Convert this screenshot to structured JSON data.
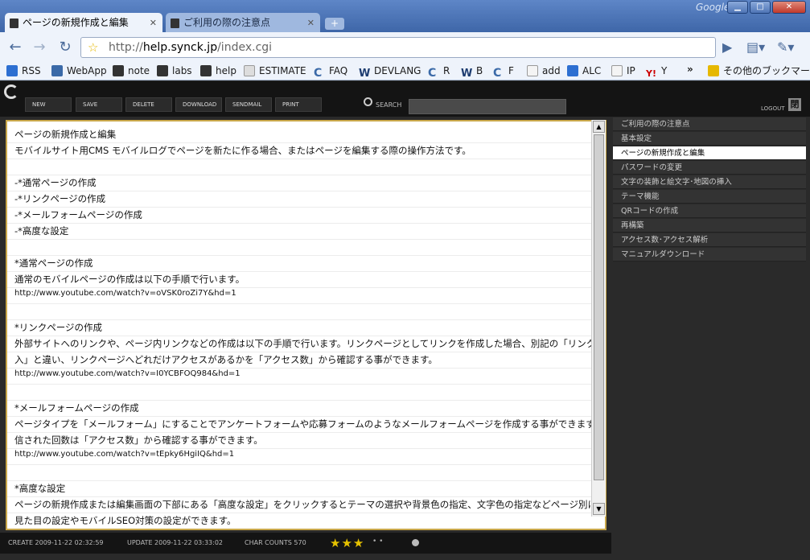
{
  "browser": {
    "brand": "Google",
    "tabs": [
      {
        "label": "ページの新規作成と編集"
      },
      {
        "label": "ご利用の際の注意点"
      }
    ],
    "url_prefix": "http://",
    "url_host": "help.synck.jp",
    "url_path": "/index.cgi",
    "bookmarks": [
      {
        "label": "RSS",
        "color": "#2d6fd1"
      },
      {
        "label": "WebApp",
        "color": "#3b6aa8"
      },
      {
        "label": "note",
        "color": "#333333"
      },
      {
        "label": "labs",
        "color": "#333333"
      },
      {
        "label": "help",
        "color": "#333333"
      },
      {
        "label": "ESTIMATE",
        "color": "#d8d8d8"
      },
      {
        "label": "FAQ",
        "color": "#3b6aa8"
      },
      {
        "label": "DEVLANG",
        "color": "#1d3c70"
      },
      {
        "label": "R",
        "color": "#3b6aa8"
      },
      {
        "label": "B",
        "color": "#1d3c70"
      },
      {
        "label": "F",
        "color": "#3b6aa8"
      },
      {
        "label": "add",
        "color": "#e8e8e8"
      },
      {
        "label": "ALC",
        "color": "#2d6fd1"
      },
      {
        "label": "IP",
        "color": "#e8e8e8"
      },
      {
        "label": "Y",
        "color": "#cc0000"
      },
      {
        "label": "その他のブックマーク",
        "color": "#e6b800"
      }
    ]
  },
  "app": {
    "buttons": [
      "NEW",
      "SAVE",
      "DELETE",
      "DOWNLOAD",
      "SENDMAIL",
      "PRINT"
    ],
    "search_label": "SEARCH",
    "search_value": "",
    "logout_label": "LOGOUT",
    "logout_icon_glyph": "閉"
  },
  "editor": {
    "lines": [
      "ページの新規作成と編集",
      "モバイルサイト用CMS モバイルログでページを新たに作る場合、またはページを編集する際の操作方法です。",
      "",
      "-*通常ページの作成",
      "-*リンクページの作成",
      "-*メールフォームページの作成",
      "-*高度な設定",
      "",
      "*通常ページの作成",
      "通常のモバイルページの作成は以下の手順で行います。",
      "http://www.youtube.com/watch?v=oVSK0roZi7Y&hd=1",
      "",
      "*リンクページの作成",
      "外部サイトへのリンクや、ページ内リンクなどの作成は以下の手順で行います。リンクページとしてリンクを作成した場合、別記の「リンクの挿",
      "入」と違い、リンクページへどれだけアクセスがあるかを「アクセス数」から確認する事ができます。",
      "http://www.youtube.com/watch?v=I0YCBFOQ984&hd=1",
      "",
      "*メールフォームページの作成",
      "ページタイプを「メールフォーム」にすることでアンケートフォームや応募フォームのようなメールフォームページを作成する事ができます。送",
      "信された回数は「アクセス数」から確認する事ができます。",
      "http://www.youtube.com/watch?v=tEpky6HgiIQ&hd=1",
      "",
      "*高度な設定",
      "ページの新規作成または編集画面の下部にある「高度な設定」をクリックするとテーマの選択や背景色の指定、文字色の指定などページ別に",
      "見た目の設定やモバイルSEO対策の設定ができます。"
    ]
  },
  "sidebar": {
    "items": [
      {
        "label": "ご利用の際の注意点",
        "active": false
      },
      {
        "label": "基本設定",
        "active": false
      },
      {
        "label": "ページの新規作成と編集",
        "active": true
      },
      {
        "label": "パスワードの変更",
        "active": false
      },
      {
        "label": "文字の装飾と絵文字･地図の挿入",
        "active": false
      },
      {
        "label": "テーマ機能",
        "active": false
      },
      {
        "label": "QRコードの作成",
        "active": false
      },
      {
        "label": "再構築",
        "active": false
      },
      {
        "label": "アクセス数･アクセス解析",
        "active": false
      },
      {
        "label": "マニュアルダウンロード",
        "active": false
      }
    ]
  },
  "status": {
    "create": "CREATE 2009-11-22 02:32:59",
    "update": "UPDATE 2009-11-22 03:33:02",
    "char_counts": "CHAR COUNTS 570",
    "stars": "★★★",
    "dots": "•   •",
    "rating": 3
  },
  "colors": {
    "editor_border": "#c9a74a",
    "accent_star": "#e6c200"
  }
}
